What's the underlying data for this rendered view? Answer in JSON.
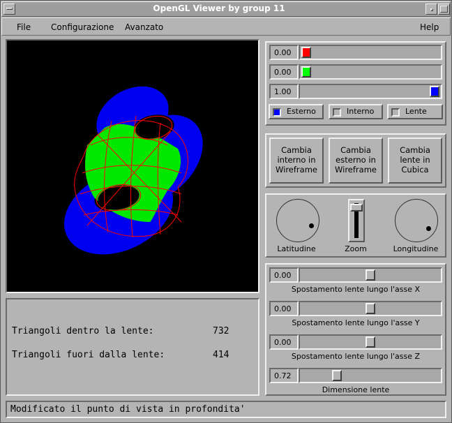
{
  "window": {
    "title": "OpenGL Viewer by group 11"
  },
  "menu": {
    "file": "File",
    "configurazione": "Configurazione",
    "avanzato": "Avanzato",
    "help": "Help"
  },
  "colors": {
    "red": {
      "value": "0.00",
      "swatch": "#ff0000"
    },
    "green": {
      "value": "0.00",
      "swatch": "#00ff00"
    },
    "blue": {
      "value": "1.00",
      "swatch": "#0000ff"
    }
  },
  "toggles": {
    "esterno": "Esterno",
    "interno": "Interno",
    "lente": "Lente",
    "esterno_swatch": "#0000ff"
  },
  "buttons": {
    "interno": [
      "Cambia",
      "interno in",
      "Wireframe"
    ],
    "esterno": [
      "Cambia",
      "esterno in",
      "Wireframe"
    ],
    "lente": [
      "Cambia",
      "lente in",
      "Cubica"
    ]
  },
  "view": {
    "latitudine": "Latitudine",
    "zoom": "Zoom",
    "longitudine": "Longitudine"
  },
  "lens": {
    "x": {
      "value": "0.00",
      "label": "Spostamento lente lungo l'asse X"
    },
    "y": {
      "value": "0.00",
      "label": "Spostamento lente lungo l'asse Y"
    },
    "z": {
      "value": "0.00",
      "label": "Spostamento lente lungo l'asse Z"
    },
    "size": {
      "value": "0.72",
      "label": "Dimensione lente"
    }
  },
  "stats": {
    "inside_label": "Triangoli dentro la lente:",
    "inside_value": "732",
    "outside_label": "Triangoli fuori dalla lente:",
    "outside_value": "414"
  },
  "status": "Modificato il punto di vista in profondita'"
}
